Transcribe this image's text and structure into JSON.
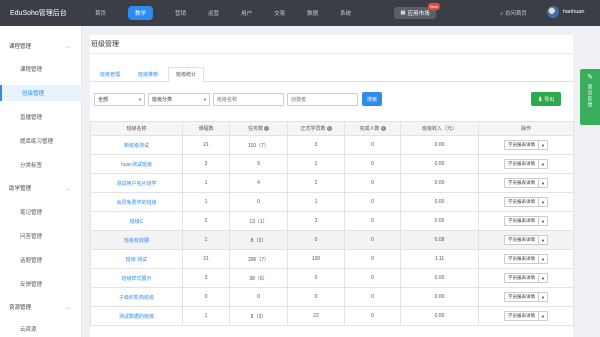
{
  "header": {
    "brand": "EduSoho管理后台",
    "nav": [
      "首页",
      "教学",
      "营销",
      "运营",
      "用户",
      "交易",
      "数据",
      "系统"
    ],
    "active_nav_index": 1,
    "app_store": "应用市场",
    "app_store_badge": "New",
    "front_link": "访问首页",
    "user": "hanhuan"
  },
  "sidebar": {
    "groups": [
      {
        "label": "课程管理",
        "items": [
          "课程管理",
          "班级管理",
          "直播管理",
          "题库练习管理",
          "分类标签"
        ]
      },
      {
        "label": "助学管理",
        "items": [
          "笔记管理",
          "问答管理",
          "话题管理",
          "反馈管理"
        ]
      },
      {
        "label": "资源管理",
        "items": [
          "云资源"
        ]
      }
    ],
    "active_item": "班级管理"
  },
  "main": {
    "title": "班级管理",
    "tabs": [
      "班级管理",
      "班级推荐",
      "班级统计"
    ],
    "active_tab": 2
  },
  "filters": {
    "status_value": "全部",
    "category_placeholder": "班级分类",
    "title_placeholder": "班级名称",
    "creator_placeholder": "创建者",
    "search_label": "搜索",
    "export_label": "导出"
  },
  "table": {
    "columns": [
      "班级名称",
      "课程数",
      "任务数",
      "正式学员数",
      "完成人数",
      "班级收入（元）",
      "操作"
    ],
    "action_label": "学员报表详情",
    "rows": [
      {
        "name": "新班级测试",
        "courses": "21",
        "tasks": "110（7）",
        "students": "3",
        "finished": "0",
        "income": "0.00"
      },
      {
        "name": "huan测试班级",
        "courses": "3",
        "tasks": "9",
        "students": "1",
        "finished": "0",
        "income": "0.00"
      },
      {
        "name": "测试用户名片班学",
        "courses": "1",
        "tasks": "4",
        "students": "2",
        "finished": "0",
        "income": "0.00"
      },
      {
        "name": "会员免费学的班级",
        "courses": "1",
        "tasks": "0",
        "students": "1",
        "finished": "0",
        "income": "0.00"
      },
      {
        "name": "班级C",
        "courses": "2",
        "tasks": "13（1）",
        "students": "3",
        "finished": "0",
        "income": "0.00"
      },
      {
        "name": "班级有效期",
        "courses": "1",
        "tasks": "8（3）",
        "students": "0",
        "finished": "0",
        "income": "0.08"
      },
      {
        "name": "班级 测试",
        "courses": "21",
        "tasks": "396（7）",
        "students": "100",
        "finished": "0",
        "income": "1.11"
      },
      {
        "name": "班级样式展示",
        "courses": "3",
        "tasks": "38（6）",
        "students": "0",
        "finished": "0",
        "income": "0.00"
      },
      {
        "name": "子级织机构班级",
        "courses": "0",
        "tasks": "0",
        "students": "0",
        "finished": "0",
        "income": "0.00"
      },
      {
        "name": "测试数据的班级",
        "courses": "1",
        "tasks": "8（3）",
        "students": "22",
        "finished": "0",
        "income": "0.00"
      }
    ]
  },
  "feedback": {
    "label": "意见反馈"
  },
  "colors": {
    "accent": "#2d8cf0",
    "topbar": "#3b3f45",
    "success": "#2ea84d"
  }
}
